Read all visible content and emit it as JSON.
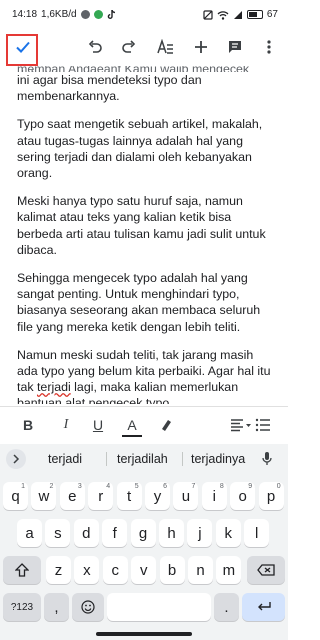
{
  "status_bar": {
    "time": "14:18",
    "speed": "1,6KB/d",
    "battery": "67"
  },
  "toolbar": {
    "confirm": "check-icon",
    "undo": "undo-icon",
    "redo": "redo-icon",
    "text_format": "text-format-icon",
    "insert": "plus-icon",
    "comment": "comment-icon",
    "more": "more-vert-icon",
    "highlight_color": "#e53935"
  },
  "document": {
    "clipped_line": "memban Andaeant Kamu wajib mengecek dulu",
    "paragraphs": [
      "ini agar bisa mendeteksi typo dan membenarkannya.",
      "Typo saat mengetik sebuah artikel, makalah, atau tugas-tugas lainnya adalah hal yang sering terjadi dan dialami oleh kebanyakan orang.",
      "Meski hanya typo satu huruf saja, namun kalimat atau teks yang kalian ketik bisa berbeda arti atau tulisan kamu jadi sulit untuk dibaca.",
      "Sehingga mengecek typo adalah hal yang sangat penting. Untuk menghindari typo, biasanya seseorang akan membaca seluruh file yang mereka ketik dengan lebih teliti."
    ],
    "last_paragraph": {
      "before": "Namun meski sudah teliti, tak jarang masih ada typo yang belum kita perbaiki. Agar hal itu tak ",
      "misspelled": "terjadi",
      "after": " lagi, maka kalian memerlukan bantuan alat pengecek typo."
    }
  },
  "format_bar": {
    "bold": "B",
    "italic": "I",
    "underline": "U",
    "text_color": "A",
    "highlight": "marker-icon",
    "align": "align-left-icon",
    "list": "list-icon"
  },
  "suggestions": [
    "terjadi",
    "terjadilah",
    "terjadinya"
  ],
  "keyboard": {
    "row1": [
      {
        "k": "q",
        "n": "1"
      },
      {
        "k": "w",
        "n": "2"
      },
      {
        "k": "e",
        "n": "3"
      },
      {
        "k": "r",
        "n": "4"
      },
      {
        "k": "t",
        "n": "5"
      },
      {
        "k": "y",
        "n": "6"
      },
      {
        "k": "u",
        "n": "7"
      },
      {
        "k": "i",
        "n": "8"
      },
      {
        "k": "o",
        "n": "9"
      },
      {
        "k": "p",
        "n": "0"
      }
    ],
    "row2": [
      "a",
      "s",
      "d",
      "f",
      "g",
      "h",
      "j",
      "k",
      "l"
    ],
    "row3": [
      "z",
      "x",
      "c",
      "v",
      "b",
      "n",
      "m"
    ],
    "symbols": "?123",
    "comma": ",",
    "period": "."
  }
}
